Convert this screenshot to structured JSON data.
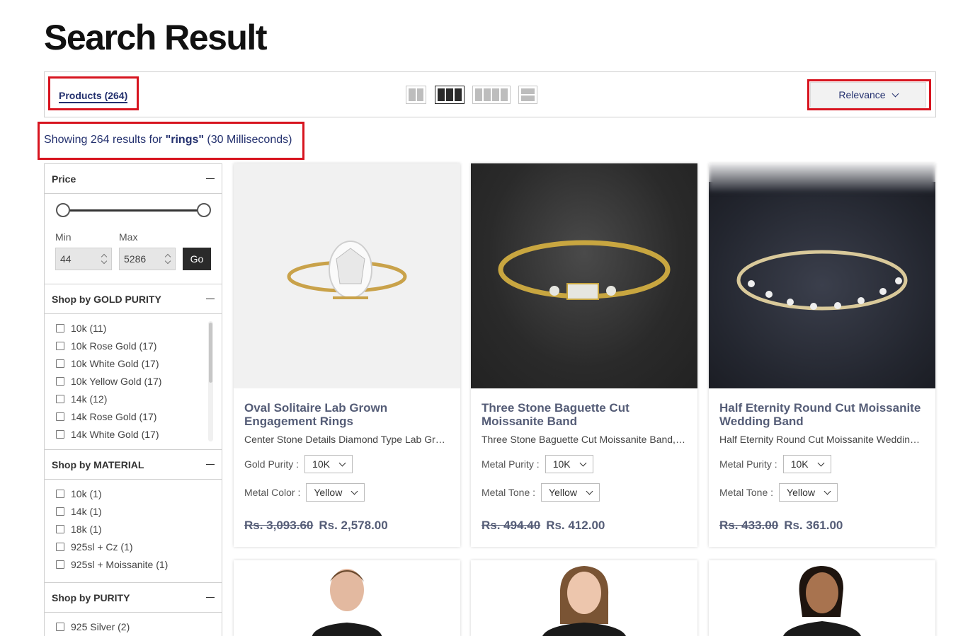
{
  "page": {
    "title": "Search Result"
  },
  "toolbar": {
    "products_tab": "Products (264)",
    "sort_label": "Relevance"
  },
  "results": {
    "prefix": "Showing 264 results for ",
    "query": "\"rings\"",
    "suffix": " (30 Milliseconds)"
  },
  "filters": {
    "price": {
      "title": "Price",
      "min_label": "Min",
      "max_label": "Max",
      "min_value": "44",
      "max_value": "5286",
      "go_label": "Go"
    },
    "gold_purity": {
      "title": "Shop by GOLD PURITY",
      "items": [
        "10k (11)",
        "10k Rose Gold (17)",
        "10k White Gold (17)",
        "10k Yellow Gold (17)",
        "14k (12)",
        "14k Rose Gold (17)",
        "14k White Gold (17)"
      ]
    },
    "material": {
      "title": "Shop by MATERIAL",
      "items": [
        "10k (1)",
        "14k (1)",
        "18k (1)",
        "925sl + Cz (1)",
        "925sl + Moissanite (1)"
      ]
    },
    "purity": {
      "title": "Shop by PURITY",
      "items": [
        "925 Silver (2)"
      ]
    }
  },
  "products": [
    {
      "title": "Oval Solitaire Lab Grown Engagement Rings",
      "desc": "Center Stone Details Diamond Type Lab Grown Diamond",
      "opt1_label": "Gold Purity :",
      "opt1_value": "10K",
      "opt2_label": "Metal Color :",
      "opt2_value": "Yellow",
      "old_price": "Rs. 3,093.60",
      "price": "Rs. 2,578.00"
    },
    {
      "title": "Three Stone Baguette Cut Moissanite Band",
      "desc": "Three Stone Baguette Cut Moissanite Band, perfect",
      "opt1_label": "Metal Purity :",
      "opt1_value": "10K",
      "opt2_label": "Metal Tone :",
      "opt2_value": "Yellow",
      "old_price": "Rs. 494.40",
      "price": "Rs. 412.00"
    },
    {
      "title": "Half Eternity Round Cut Moissanite Wedding Band",
      "desc": "Half Eternity Round Cut Moissanite Wedding Band",
      "opt1_label": "Metal Purity :",
      "opt1_value": "10K",
      "opt2_label": "Metal Tone :",
      "opt2_value": "Yellow",
      "old_price": "Rs. 433.00",
      "price": "Rs. 361.00"
    }
  ],
  "colors": {
    "accent": "#23306e",
    "highlight": "#d7141f"
  }
}
